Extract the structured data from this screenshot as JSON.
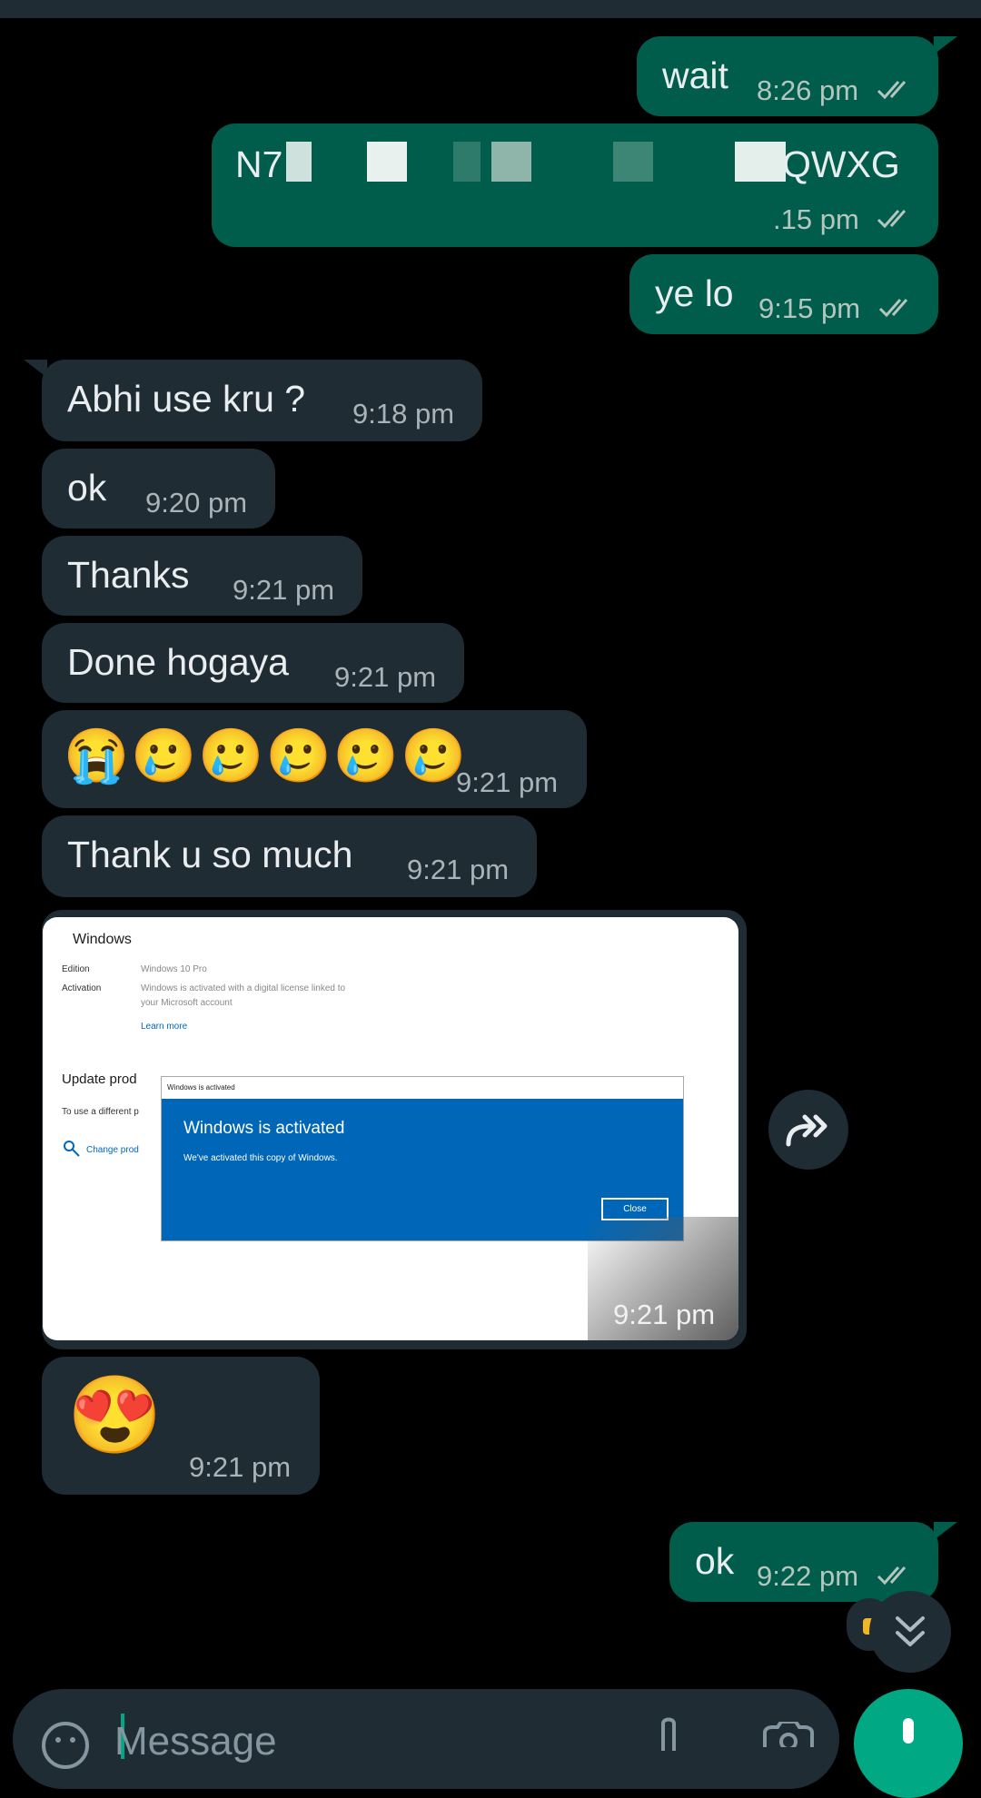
{
  "colors": {
    "background": "#000000",
    "outgoing_bubble": "#005c4b",
    "incoming_bubble": "#1f2c34",
    "accent": "#00a884",
    "read_ticks": "#b5c6c0"
  },
  "messages": [
    {
      "direction": "outgoing",
      "text": "wait",
      "time": "8:26 pm",
      "status": "read"
    },
    {
      "direction": "outgoing",
      "text_start": "N7",
      "text_end": "QWXG",
      "redacted": true,
      "time": ".15 pm",
      "status": "read"
    },
    {
      "direction": "outgoing",
      "text": "ye lo",
      "time": "9:15 pm",
      "status": "read"
    },
    {
      "direction": "incoming",
      "text": "Abhi use kru ?",
      "time": "9:18 pm"
    },
    {
      "direction": "incoming",
      "text": "ok",
      "time": "9:20 pm"
    },
    {
      "direction": "incoming",
      "text": "Thanks",
      "time": "9:21 pm"
    },
    {
      "direction": "incoming",
      "text": "Done hogaya",
      "time": "9:21 pm"
    },
    {
      "direction": "incoming",
      "text": "😭🥲🥲🥲🥲🥲",
      "time": "9:21 pm"
    },
    {
      "direction": "incoming",
      "text": "Thank u so much",
      "time": "9:21 pm"
    },
    {
      "direction": "incoming",
      "type": "image",
      "time": "9:21 pm",
      "image": {
        "title": "Windows",
        "edition_label": "Edition",
        "edition_value": "Windows 10 Pro",
        "activation_label": "Activation",
        "activation_value_1": "Windows is activated with a digital license linked to",
        "activation_value_2": "your Microsoft account",
        "learn_more": "Learn more",
        "update_heading": "Update prod",
        "update_text": "To use a different p",
        "change_link": "Change prod",
        "dialog_titlebar": "Windows is activated",
        "dialog_heading": "Windows is activated",
        "dialog_text": "We've activated this copy of Windows.",
        "dialog_button": "Close"
      }
    },
    {
      "direction": "incoming",
      "text": "😍",
      "time": "9:21 pm"
    },
    {
      "direction": "outgoing",
      "text": "ok",
      "time": "9:22 pm",
      "status": "read"
    }
  ],
  "icons": {
    "forward": "forward-icon",
    "scroll_down": "double-chevron-down-icon",
    "emoji": "emoji-icon",
    "attach": "paperclip-icon",
    "camera": "camera-icon",
    "mic": "mic-icon"
  },
  "composer": {
    "placeholder": "Message"
  }
}
